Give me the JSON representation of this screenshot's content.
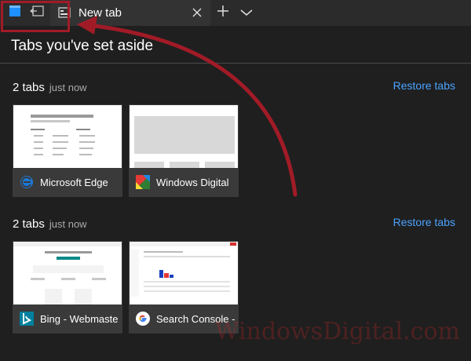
{
  "titlebar": {
    "tab_label": "New tab",
    "icons": [
      "set-aside-tabs-icon",
      "view-set-aside-icon",
      "tab-page-icon",
      "close-icon",
      "new-tab-plus-icon",
      "tab-preview-chevron-icon"
    ]
  },
  "pane": {
    "title": "Tabs you've set aside",
    "groups": [
      {
        "count_label": "2 tabs",
        "time_label": "just now",
        "restore_label": "Restore tabs",
        "tabs": [
          {
            "title": "Microsoft Edge",
            "icon": "edge-e-icon"
          },
          {
            "title": "Windows Digital",
            "icon": "windows-digital-logo-icon"
          }
        ]
      },
      {
        "count_label": "2 tabs",
        "time_label": "just now",
        "restore_label": "Restore tabs",
        "tabs": [
          {
            "title": "Bing - Webmaste",
            "icon": "bing-b-icon"
          },
          {
            "title": "Search Console -",
            "icon": "google-g-icon"
          }
        ]
      }
    ]
  },
  "watermark": "WindowsDigital.com",
  "colors": {
    "accent": "#4aa3ff",
    "annotation": "#a11b27"
  }
}
